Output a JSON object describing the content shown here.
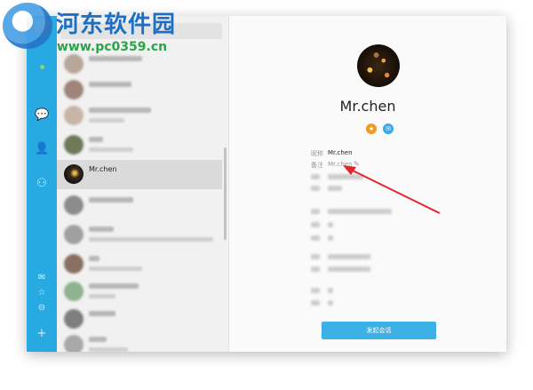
{
  "watermark": {
    "site_name": "河东软件园",
    "url": "www.pc0359.cn"
  },
  "sidebar": {
    "icons": [
      "chat-icon",
      "contact-icon",
      "group-icon",
      "mail-icon",
      "star-icon",
      "minus-circle-icon",
      "plus-icon"
    ]
  },
  "contacts": {
    "selected_name": "Mr.chen"
  },
  "profile": {
    "name": "Mr.chen",
    "nickname_label": "昵称",
    "nickname_value": "Mr.chen",
    "remark_label": "备注",
    "remark_value": "Mr.chen",
    "start_chat_button": "发起会话"
  },
  "colors": {
    "rail": "#27a9e1",
    "button": "#3cb1e6",
    "annotation_arrow": "#e3262b",
    "badge_orange": "#f29a1e",
    "badge_blue": "#3aa9e6"
  }
}
